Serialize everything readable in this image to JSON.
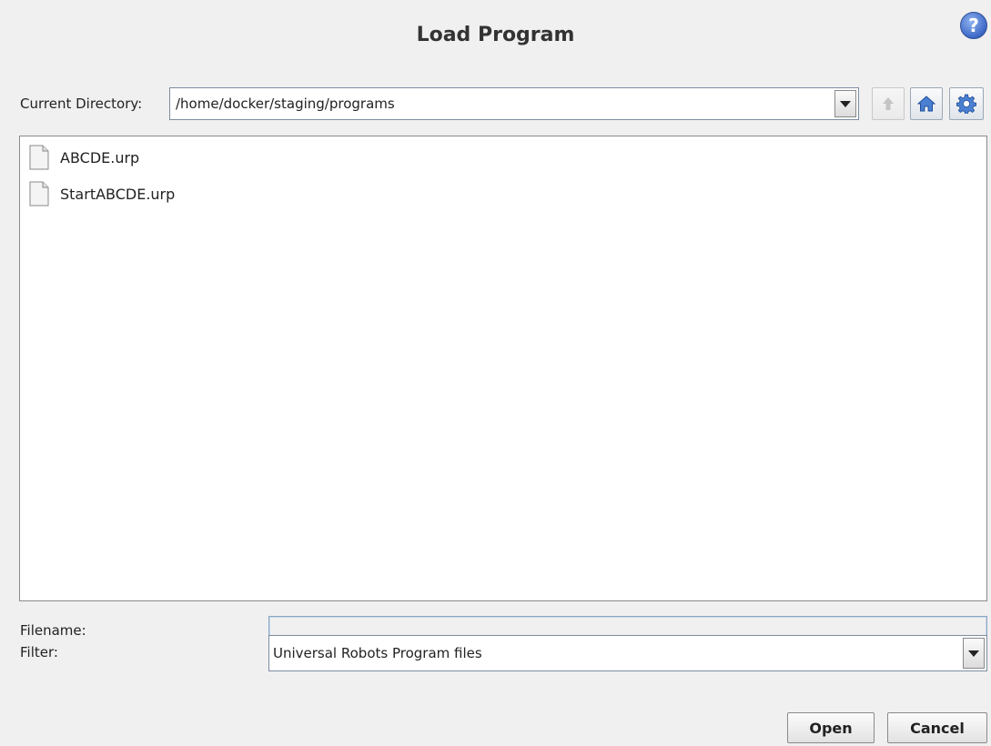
{
  "dialog": {
    "title": "Load Program",
    "help_symbol": "?"
  },
  "directory": {
    "label": "Current Directory:",
    "value": "/home/docker/staging/programs"
  },
  "toolbar": {
    "up_icon": "arrow-up-icon",
    "home_icon": "home-icon",
    "settings_icon": "gear-icon"
  },
  "files": [
    {
      "name": "ABCDE.urp"
    },
    {
      "name": "StartABCDE.urp"
    }
  ],
  "filename": {
    "label": "Filename:",
    "value": ""
  },
  "filter": {
    "label": "Filter:",
    "value": "Universal Robots Program files"
  },
  "buttons": {
    "open": "Open",
    "cancel": "Cancel"
  },
  "colors": {
    "background": "#f0f0f0",
    "accent": "#3c68c7"
  }
}
